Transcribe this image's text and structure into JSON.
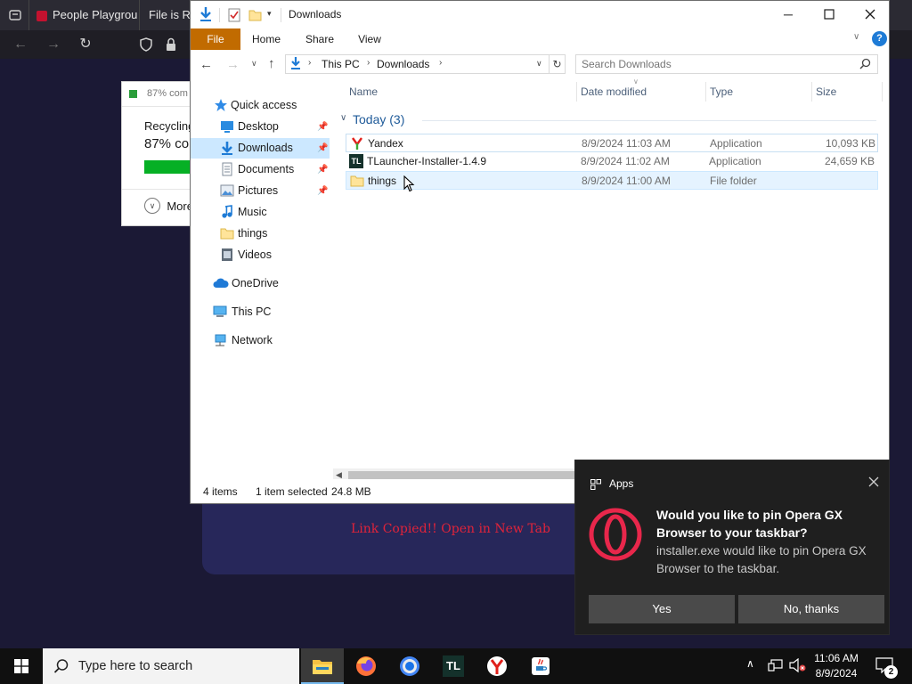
{
  "browser": {
    "tabs": [
      {
        "label": "People Playgrou"
      },
      {
        "label": "File is Re"
      }
    ]
  },
  "webpage": {
    "link_copied_text": "Link Copied!! Open in New Tab"
  },
  "recycle_dialog": {
    "header": "87% com",
    "label": "Recycling",
    "percent": "87% co",
    "progress": 0.87,
    "more_label": "More"
  },
  "explorer": {
    "title": "Downloads",
    "ribbon_tabs": [
      {
        "label": "File"
      },
      {
        "label": "Home"
      },
      {
        "label": "Share"
      },
      {
        "label": "View"
      }
    ],
    "breadcrumb": [
      {
        "label": "This PC"
      },
      {
        "label": "Downloads"
      }
    ],
    "search_placeholder": "Search Downloads",
    "nav": {
      "quick_access": "Quick access",
      "items": [
        {
          "label": "Desktop",
          "icon": "desktop-icon",
          "pinned": true
        },
        {
          "label": "Downloads",
          "icon": "download-icon",
          "pinned": true
        },
        {
          "label": "Documents",
          "icon": "documents-icon",
          "pinned": true
        },
        {
          "label": "Pictures",
          "icon": "pictures-icon",
          "pinned": true
        },
        {
          "label": "Music",
          "icon": "music-icon",
          "pinned": false
        },
        {
          "label": "things",
          "icon": "folder-icon",
          "pinned": false
        },
        {
          "label": "Videos",
          "icon": "videos-icon",
          "pinned": false
        }
      ],
      "onedrive": "OneDrive",
      "this_pc": "This PC",
      "network": "Network"
    },
    "columns": {
      "name": "Name",
      "date": "Date modified",
      "type": "Type",
      "size": "Size"
    },
    "group_label": "Today (3)",
    "files": [
      {
        "name": "Yandex",
        "date": "8/9/2024 11:03 AM",
        "type": "Application",
        "size": "10,093 KB",
        "icon": "yandex-icon"
      },
      {
        "name": "TLauncher-Installer-1.4.9",
        "date": "8/9/2024 11:02 AM",
        "type": "Application",
        "size": "24,659 KB",
        "icon": "tlauncher-icon"
      },
      {
        "name": "things",
        "date": "8/9/2024 11:00 AM",
        "type": "File folder",
        "size": "",
        "icon": "folder-icon"
      }
    ],
    "status": {
      "items": "4 items",
      "selected": "1 item selected",
      "size": "24.8 MB"
    },
    "colors": {
      "file_tab": "#c16b00",
      "selection": "#cce8ff",
      "header_text": "#4c607a"
    }
  },
  "toast": {
    "app": "Apps",
    "title": "Would you like to pin Opera GX Browser to your taskbar?",
    "body": "installer.exe would like to pin Opera GX Browser to the taskbar.",
    "yes_label": "Yes",
    "no_label": "No, thanks",
    "accent": "#e8274b"
  },
  "taskbar": {
    "search_placeholder": "Type here to search",
    "time": "11:06 AM",
    "date": "8/9/2024",
    "notification_count": "2"
  }
}
